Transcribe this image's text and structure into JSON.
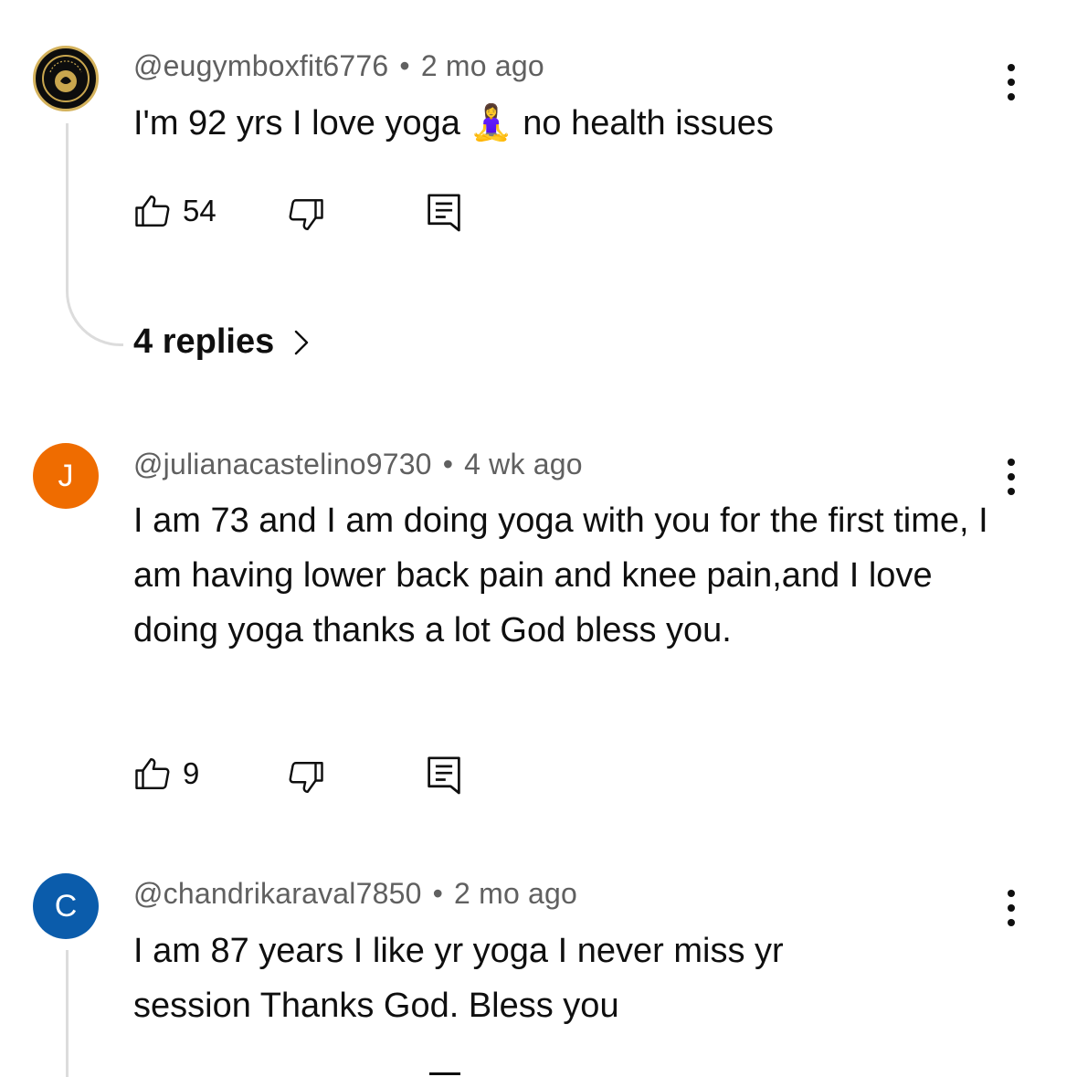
{
  "comments": [
    {
      "handle": "@eugymboxfit6776",
      "time": "2 mo ago",
      "text": "I'm 92 yrs I love yoga 🧘‍♀️  no health issues",
      "likes": "54",
      "avatar_letter": "",
      "avatar_logo_text": "EUGYM BOXFIT",
      "avatar_color": "#0d0d0d",
      "replies_label": "4 replies"
    },
    {
      "handle": "@julianacastelino9730",
      "time": "4 wk ago",
      "text": "I am 73 and I am doing yoga with  you for  the first  time, I am having  lower back pain  and knee pain,and I love doing  yoga thanks a lot God bless you.",
      "likes": "9",
      "avatar_letter": "J",
      "avatar_color": "#ef6c00"
    },
    {
      "handle": "@chandrikaraval7850",
      "time": "2 mo ago",
      "text": "I am 87 years I like yr yoga I never miss yr session Thanks God. Bless you",
      "avatar_letter": "C",
      "avatar_color": "#0b5cab"
    }
  ],
  "separator": "•",
  "icons": {
    "like": "thumbs-up-icon",
    "dislike": "thumbs-down-icon",
    "reply": "comment-reply-icon",
    "more": "more-vertical-icon",
    "chevron": "chevron-right-icon"
  }
}
